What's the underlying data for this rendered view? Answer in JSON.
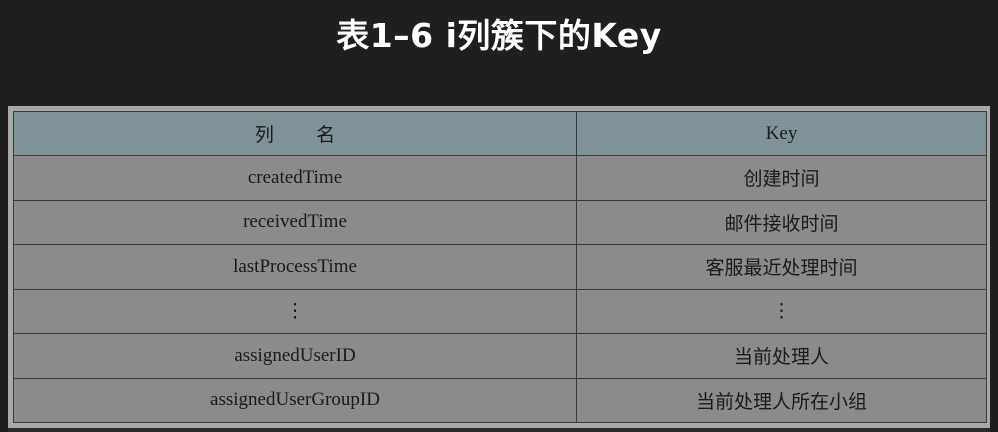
{
  "title": "表1–6 i列簇下的Key",
  "table": {
    "headers": [
      "列       名",
      "Key"
    ],
    "rows": [
      [
        "createdTime",
        "创建时间"
      ],
      [
        "receivedTime",
        "邮件接收时间"
      ],
      [
        "lastProcessTime",
        "客服最近处理时间"
      ],
      [
        "⋮",
        "⋮"
      ],
      [
        "assignedUserID",
        "当前处理人"
      ],
      [
        "assignedUserGroupID",
        "当前处理人所在小组"
      ]
    ]
  }
}
